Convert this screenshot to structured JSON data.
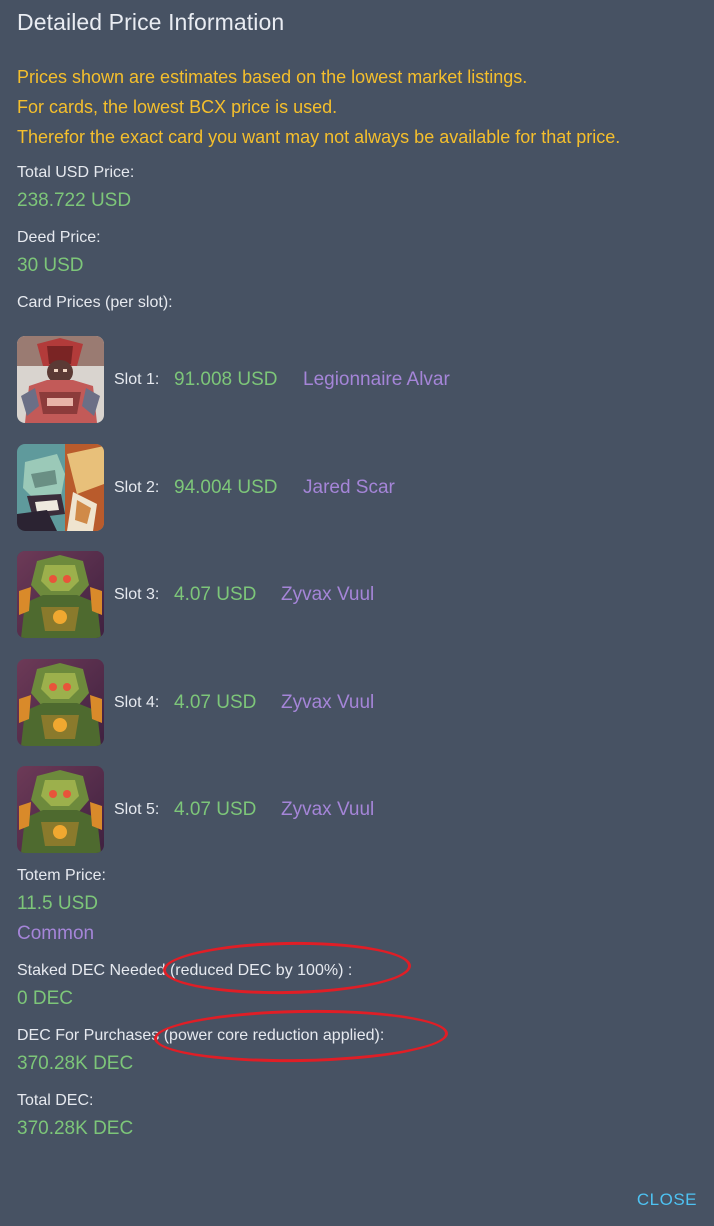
{
  "dialog": {
    "title": "Detailed Price Information",
    "notice_lines": [
      "Prices shown are estimates based on the lowest market listings.",
      "For cards, the lowest BCX price is used.",
      "Therefor the exact card you want may not always be available for that price."
    ],
    "total_usd": {
      "label": "Total USD Price:",
      "value": "238.722 USD"
    },
    "deed": {
      "label": "Deed Price:",
      "value": "30 USD"
    },
    "card_prices_label": "Card Prices (per slot):",
    "cards": [
      {
        "slot": "Slot 1:",
        "price": "91.008 USD",
        "name": "Legionnaire Alvar",
        "art": "legionnaire-alvar-card-art"
      },
      {
        "slot": "Slot 2:",
        "price": "94.004 USD",
        "name": "Jared Scar",
        "art": "jared-scar-card-art"
      },
      {
        "slot": "Slot 3:",
        "price": "4.07 USD",
        "name": "Zyvax Vuul",
        "art": "zyvax-vuul-card-art"
      },
      {
        "slot": "Slot 4:",
        "price": "4.07 USD",
        "name": "Zyvax Vuul",
        "art": "zyvax-vuul-card-art"
      },
      {
        "slot": "Slot 5:",
        "price": "4.07 USD",
        "name": "Zyvax Vuul",
        "art": "zyvax-vuul-card-art"
      }
    ],
    "totem": {
      "label": "Totem Price:",
      "value": "11.5 USD",
      "rarity": "Common"
    },
    "staked_dec": {
      "label": "Staked DEC Needed (reduced DEC by 100%) :",
      "value": "0 DEC"
    },
    "dec_purchases": {
      "label": "DEC For Purchases (power core reduction applied):",
      "value": "370.28K DEC"
    },
    "total_dec": {
      "label": "Total DEC:",
      "value": "370.28K DEC"
    },
    "close_label": "CLOSE"
  },
  "colors": {
    "background": "#475263",
    "notice": "#f5bf2c",
    "price_green": "#7dc679",
    "name_purple": "#a585d8",
    "close_blue": "#4ec2f2",
    "annotation_red": "#e01e26"
  }
}
